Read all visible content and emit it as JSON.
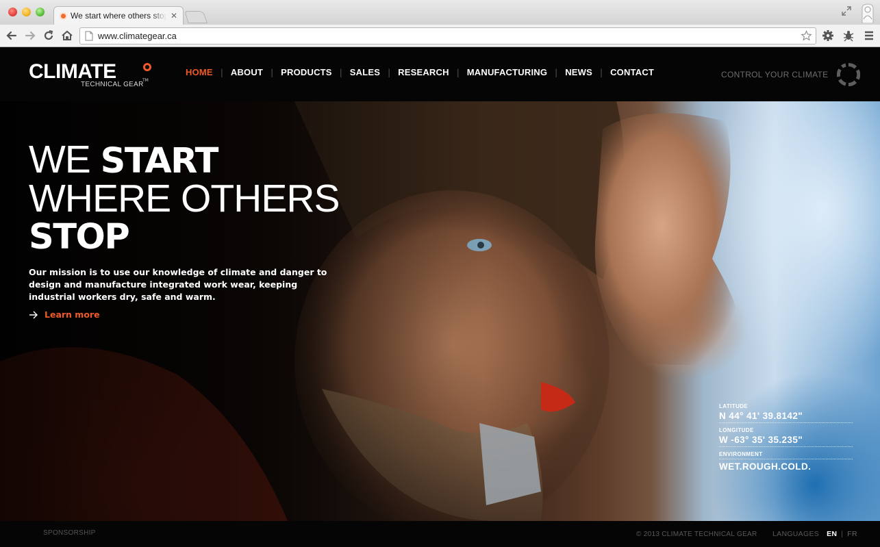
{
  "browser": {
    "tab_title": "We start where others stop",
    "url": "www.climategear.ca"
  },
  "brand": {
    "name": "CLIMATE",
    "tagline": "TECHNICAL GEAR",
    "trademark": "TM",
    "accent_color": "#f05a28"
  },
  "nav": {
    "items": [
      {
        "label": "HOME",
        "active": true
      },
      {
        "label": "ABOUT",
        "active": false
      },
      {
        "label": "PRODUCTS",
        "active": false
      },
      {
        "label": "SALES",
        "active": false
      },
      {
        "label": "RESEARCH",
        "active": false
      },
      {
        "label": "MANUFACTURING",
        "active": false
      },
      {
        "label": "NEWS",
        "active": false
      },
      {
        "label": "CONTACT",
        "active": false
      }
    ],
    "control_label": "CONTROL YOUR CLIMATE"
  },
  "hero": {
    "headline_1_light": "WE ",
    "headline_1_bold": "START",
    "headline_2_light": "WHERE OTHERS",
    "headline_3_bold": "STOP",
    "mission": "Our mission is to use our knowledge of climate and danger to design and manufacture integrated work wear, keeping industrial workers dry, safe and warm.",
    "learn_more": "Learn more"
  },
  "coordinates": {
    "latitude_label": "LATITUDE",
    "latitude_value": "N 44° 41' 39.8142\"",
    "longitude_label": "LONGITUDE",
    "longitude_value": "W -63° 35' 35.235\"",
    "environment_label": "ENVIRONMENT",
    "environment_value": "WET.ROUGH.COLD."
  },
  "footer": {
    "sponsorship": "SPONSORSHIP",
    "copyright": "© 2013 CLIMATE TECHNICAL GEAR",
    "languages_label": "LANGUAGES",
    "lang_en": "EN",
    "lang_sep": "|",
    "lang_fr": "FR"
  }
}
